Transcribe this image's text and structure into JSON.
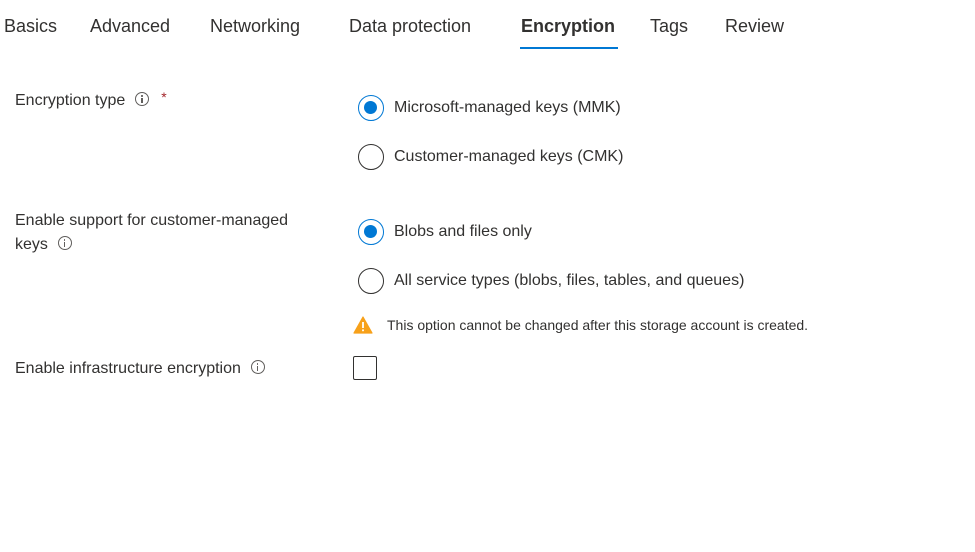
{
  "tabs": [
    {
      "label": "Basics",
      "active": false
    },
    {
      "label": "Advanced",
      "active": false
    },
    {
      "label": "Networking",
      "active": false
    },
    {
      "label": "Data protection",
      "active": false
    },
    {
      "label": "Encryption",
      "active": true
    },
    {
      "label": "Tags",
      "active": false
    },
    {
      "label": "Review",
      "active": false
    }
  ],
  "accent_color": "#0078d4",
  "warning_color": "#f7a11a",
  "required_color": "#a4262c",
  "encryption_type": {
    "label": "Encryption type",
    "required_mark": "*",
    "info_icon": "info-icon",
    "options": [
      {
        "label": "Microsoft-managed keys (MMK)",
        "selected": true
      },
      {
        "label": "Customer-managed keys (CMK)",
        "selected": false
      }
    ]
  },
  "cmk_support": {
    "label_line1": "Enable support for customer-managed",
    "label_line2": "keys",
    "info_icon": "info-icon",
    "options": [
      {
        "label": "Blobs and files only",
        "selected": true
      },
      {
        "label": "All service types (blobs, files, tables, and queues)",
        "selected": false
      }
    ],
    "warning_icon": "warning-icon",
    "warning": "This option cannot be changed after this storage account is created."
  },
  "infrastructure_encryption": {
    "label": "Enable infrastructure encryption",
    "info_icon": "info-icon",
    "checked": false
  }
}
